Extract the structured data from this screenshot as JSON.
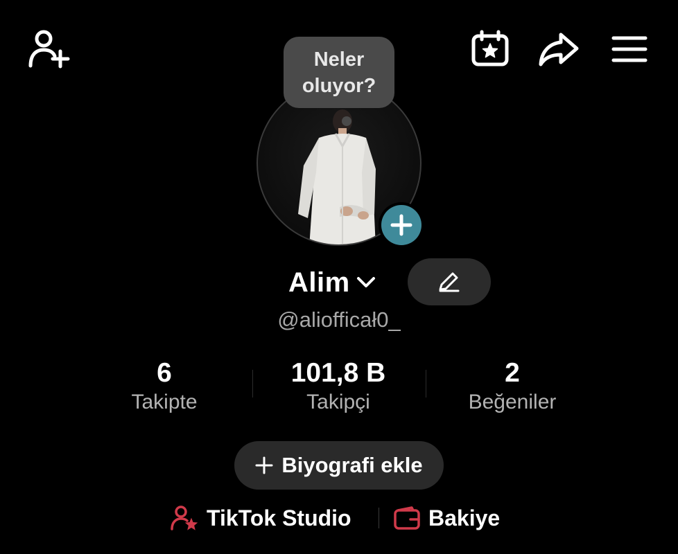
{
  "topbar": {
    "icons": [
      "add-friend-icon",
      "calendar-star-icon",
      "share-icon",
      "menu-icon"
    ]
  },
  "tooltip": {
    "line1": "Neler",
    "line2": "oluyor?"
  },
  "profile": {
    "name": "Alim",
    "handle": "@aliofficał0_"
  },
  "stats": [
    {
      "value": "6",
      "label": "Takipte"
    },
    {
      "value": "101,8 B",
      "label": "Takipçi"
    },
    {
      "value": "2",
      "label": "Beğeniler"
    }
  ],
  "bio_button": {
    "label": "Biyografi ekle"
  },
  "links": {
    "studio": "TikTok Studio",
    "balance": "Bakiye"
  },
  "colors": {
    "background": "#000000",
    "accent_teal": "#3f8a9a",
    "accent_red": "#d03a4a",
    "pill_bg": "#2a2a2a",
    "muted_text": "#b3b3b3"
  }
}
